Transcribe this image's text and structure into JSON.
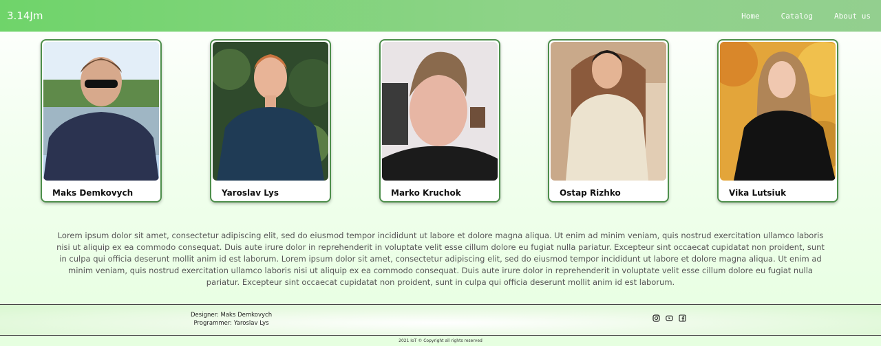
{
  "navbar": {
    "brand": "3.14Jm",
    "links": [
      "Home",
      "Catalog",
      "About us"
    ]
  },
  "team": [
    {
      "name": "Maks Demkovych",
      "photo": "person-photo"
    },
    {
      "name": "Yaroslav Lys",
      "photo": "person-photo"
    },
    {
      "name": "Marko Kruchok",
      "photo": "person-photo"
    },
    {
      "name": "Ostap Rizhko",
      "photo": "person-photo"
    },
    {
      "name": "Vika Lutsiuk",
      "photo": "person-photo"
    }
  ],
  "about": {
    "text": "Lorem ipsum dolor sit amet, consectetur adipiscing elit, sed do eiusmod tempor incididunt ut labore et dolore magna aliqua. Ut enim ad minim veniam, quis nostrud exercitation ullamco laboris nisi ut aliquip ex ea commodo consequat. Duis aute irure dolor in reprehenderit in voluptate velit esse cillum dolore eu fugiat nulla pariatur. Excepteur sint occaecat cupidatat non proident, sunt in culpa qui officia deserunt mollit anim id est laborum. Lorem ipsum dolor sit amet, consectetur adipiscing elit, sed do eiusmod tempor incididunt ut labore et dolore magna aliqua. Ut enim ad minim veniam, quis nostrud exercitation ullamco laboris nisi ut aliquip ex ea commodo consequat. Duis aute irure dolor in reprehenderit in voluptate velit esse cillum dolore eu fugiat nulla pariatur. Excepteur sint occaecat cupidatat non proident, sunt in culpa qui officia deserunt mollit anim id est laborum."
  },
  "footer": {
    "designer": "Designer: Maks Demkovych",
    "programmer": "Programmer: Yaroslav Lys",
    "socials": [
      "instagram-icon",
      "youtube-icon",
      "facebook-icon"
    ],
    "copyright": "2021 IoT © Copyright all rights reserved"
  },
  "colors": {
    "navbar_start": "#6fd46a",
    "navbar_end": "#93cf8f",
    "card_border": "#4d8f4b",
    "page_bg": "#e6ffe0"
  }
}
